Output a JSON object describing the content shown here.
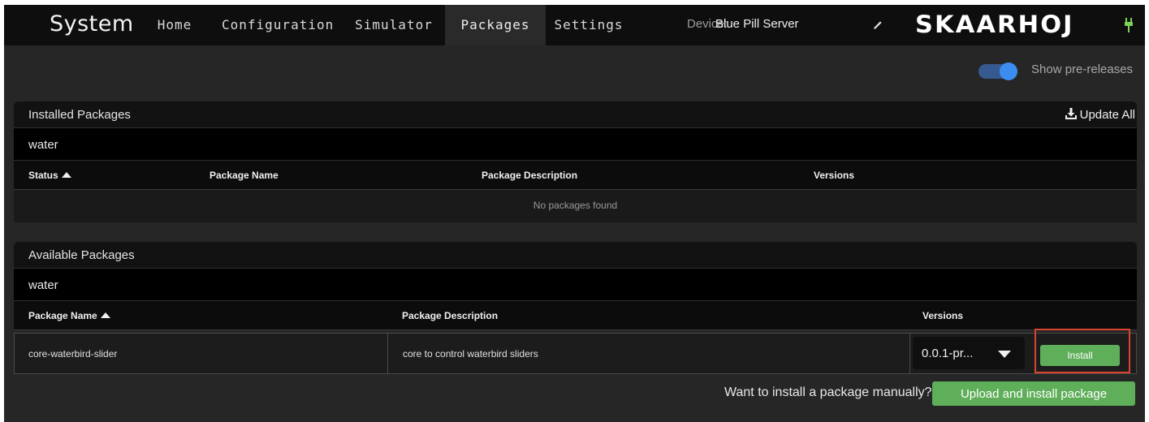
{
  "nav": {
    "title": "System",
    "items": [
      "Home",
      "Configuration",
      "Simulator",
      "Packages",
      "Settings"
    ],
    "device_label": "Device:",
    "device_name": "Blue Pill Server",
    "logo": "SKAARHOJ",
    "icons": {
      "edit": "pencil-icon",
      "status": "plug-icon"
    }
  },
  "toggle": {
    "label": "Show pre-releases",
    "on": true,
    "color": "#3b8ef0"
  },
  "installed": {
    "title": "Installed Packages",
    "update_all": "Update All",
    "filter_value": "water",
    "columns": [
      "Status",
      "Package Name",
      "Package Description",
      "Versions"
    ],
    "empty_text": "No packages found"
  },
  "available": {
    "title": "Available Packages",
    "filter_value": "water",
    "columns": [
      "Package Name",
      "Package Description",
      "Versions"
    ],
    "rows": [
      {
        "name": "core-waterbird-slider",
        "description": "core to control waterbird sliders",
        "version": "0.0.1-pr...",
        "action": "Install"
      }
    ]
  },
  "footer": {
    "manual_text": "Want to install a package manually?",
    "upload_button": "Upload and install package"
  },
  "colors": {
    "accent_green": "#5fae5a",
    "highlight_frame": "#d9442e"
  }
}
